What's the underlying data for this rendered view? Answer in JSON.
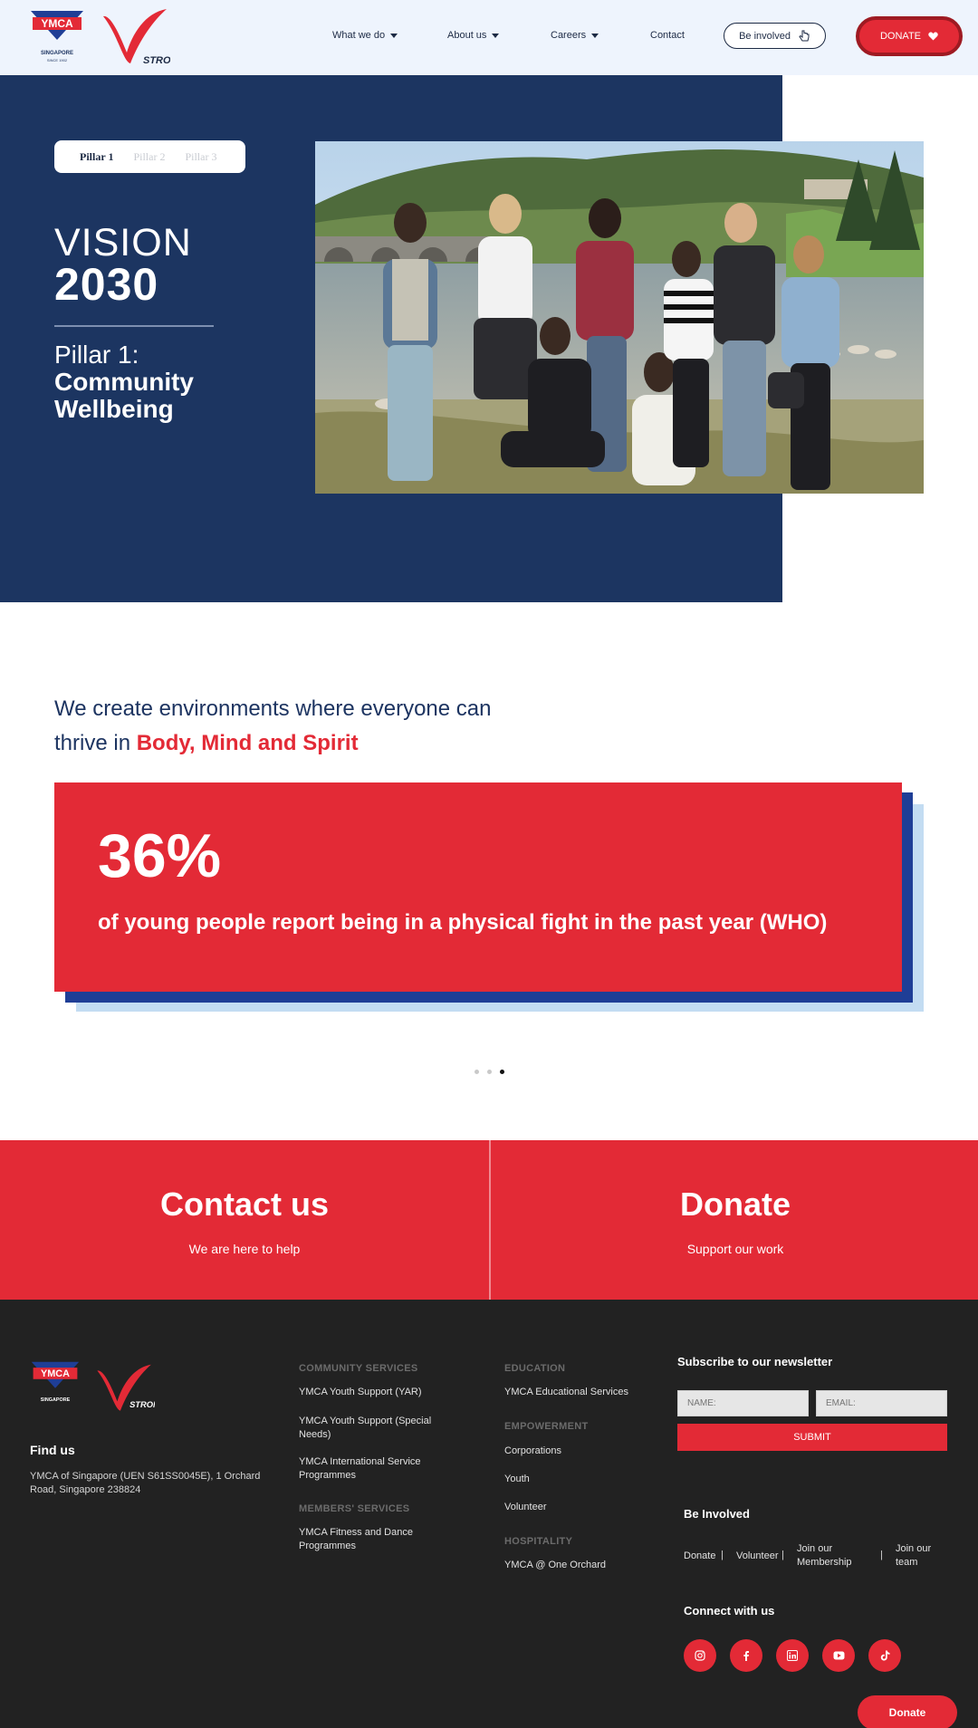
{
  "header": {
    "ymca_logo_text": "YMCA",
    "ymca_logo_sub": "SINGAPORE",
    "ymca_logo_since": "SINCE 1902",
    "strong_logo_text": "STRONG",
    "nav": [
      {
        "label": "What we do"
      },
      {
        "label": "About us"
      },
      {
        "label": "Careers"
      },
      {
        "label": "Contact"
      }
    ],
    "be_involved_label": "Be involved",
    "donate_label": "DONATE"
  },
  "hero": {
    "tabs": [
      "Pillar 1",
      "Pillar 2",
      "Pillar 3"
    ],
    "active_tab": 0,
    "vision_word": "VISION",
    "vision_year": "2030",
    "pillar_label": "Pillar 1:",
    "pillar_name_line1": "Community",
    "pillar_name_line2": "Wellbeing"
  },
  "mission": {
    "line1": "We create environments where everyone can",
    "line2_prefix": "thrive in ",
    "line2_accent": "Body, Mind and Spirit"
  },
  "stat": {
    "number": "36%",
    "text": "of young people report being in a physical fight in the past year (WHO)",
    "dots": 3,
    "active_dot": 2
  },
  "cta": {
    "contact_title": "Contact us",
    "contact_sub": "We are here to help",
    "donate_title": "Donate",
    "donate_sub": "Support our work"
  },
  "footer": {
    "find_us_title": "Find us",
    "address": "YMCA of Singapore (UEN S61SS0045E), 1 Orchard Road, Singapore 238824",
    "col1": {
      "cat1": "COMMUNITY SERVICES",
      "cat1_links": [
        "YMCA Youth Support (YAR)",
        "YMCA Youth Support (Special Needs)",
        "YMCA International Service Programmes"
      ],
      "cat2": "MEMBERS' SERVICES",
      "cat2_links": [
        "YMCA Fitness and Dance Programmes"
      ]
    },
    "col2": {
      "cat1": "EDUCATION",
      "cat1_links": [
        "YMCA Educational Services"
      ],
      "cat2": "EMPOWERMENT",
      "cat2_links": [
        "Corporations",
        "Youth",
        "Volunteer"
      ],
      "cat3": "HOSPITALITY",
      "cat3_links": [
        "YMCA @ One Orchard"
      ]
    },
    "newsletter": {
      "title": "Subscribe to our newsletter",
      "name_placeholder": "NAME:",
      "email_placeholder": "EMAIL:",
      "submit_label": "SUBMIT"
    },
    "be_involved": {
      "title": "Be Involved",
      "links": [
        "Donate",
        "Volunteer",
        "Join our Membership",
        "Join our team"
      ]
    },
    "connect": {
      "title": "Connect with us",
      "icons": [
        "instagram-icon",
        "facebook-icon",
        "linkedin-icon",
        "youtube-icon",
        "tiktok-icon"
      ]
    },
    "float_donate_label": "Donate"
  },
  "colors": {
    "navy": "#1c3561",
    "red": "#e32a36",
    "footer_bg": "#222222",
    "header_bg": "#eef4fd"
  }
}
